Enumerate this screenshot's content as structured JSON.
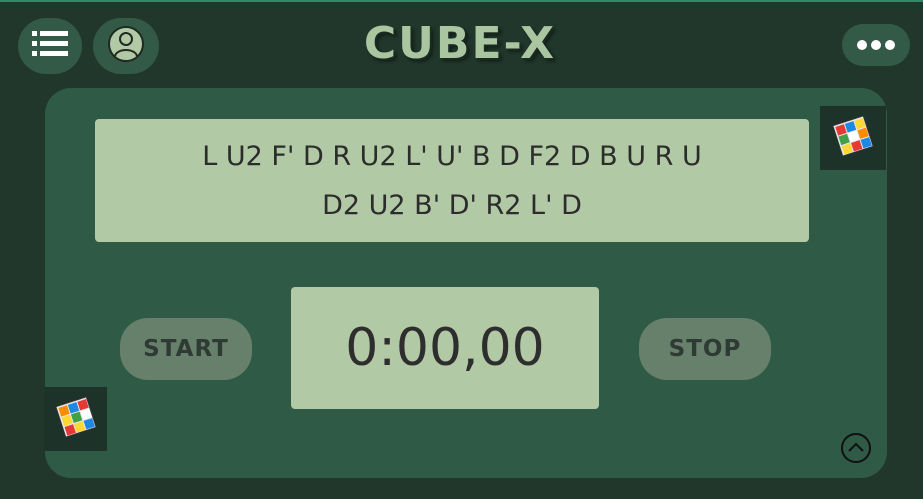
{
  "header": {
    "title": "CUBE-X",
    "menu_icon": "list-icon",
    "profile_icon": "user-icon",
    "more_icon": "more-horizontal-icon"
  },
  "scramble": {
    "line1": "L U2 F' D R U2 L' U' B D F2 D B U R U",
    "line2": "D2 U2 B' D' R2 L' D"
  },
  "timer": {
    "display": "0:00,00"
  },
  "controls": {
    "start_label": "START",
    "stop_label": "STOP"
  },
  "icons": {
    "cube_top": "rubiks-cube-icon",
    "cube_bottom": "rubiks-cube-icon",
    "scroll_top": "chevron-up-circle-icon"
  },
  "colors": {
    "background": "#21372b",
    "panel": "#2f5a46",
    "display": "#b1c9a5",
    "button": "#66806b",
    "title": "#a9c6a0"
  }
}
